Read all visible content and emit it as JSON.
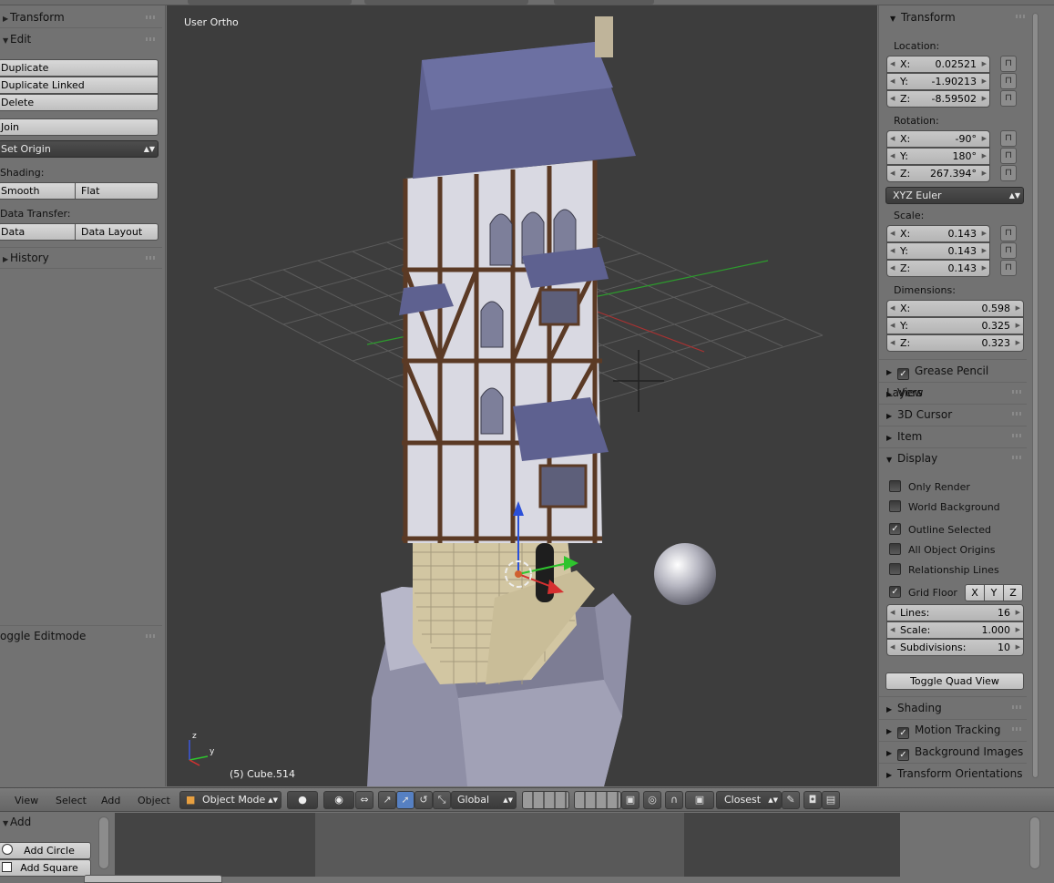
{
  "left_panel": {
    "transform_header": "Transform",
    "edit_header": "Edit",
    "duplicate": "Duplicate",
    "duplicate_linked": "Duplicate Linked",
    "delete": "Delete",
    "join": "Join",
    "set_origin": "Set Origin",
    "shading_label": "Shading:",
    "smooth": "Smooth",
    "flat": "Flat",
    "data_transfer_label": "Data Transfer:",
    "data": "Data",
    "data_layout": "Data Layout",
    "history_header": "History",
    "toggle_editmode": "oggle Editmode"
  },
  "viewport": {
    "view_label": "User Ortho",
    "object_label": "(5) Cube.514",
    "axis_z": "z",
    "axis_y": "y"
  },
  "right_panel": {
    "transform_header": "Transform",
    "location_label": "Location:",
    "location": {
      "x": "0.02521",
      "y": "-1.90213",
      "z": "-8.59502"
    },
    "rotation_label": "Rotation:",
    "rotation": {
      "x": "-90°",
      "y": "180°",
      "z": "267.394°"
    },
    "rotation_mode": "XYZ Euler",
    "scale_label": "Scale:",
    "scale": {
      "x": "0.143",
      "y": "0.143",
      "z": "0.143"
    },
    "dimensions_label": "Dimensions:",
    "dimensions": {
      "x": "0.598",
      "y": "0.325",
      "z": "0.323"
    },
    "axis": {
      "x": "X:",
      "y": "Y:",
      "z": "Z:"
    },
    "grease_pencil": "Grease Pencil Layers",
    "view": "View",
    "cursor_3d": "3D Cursor",
    "item": "Item",
    "display": "Display",
    "only_render": "Only Render",
    "world_background": "World Background",
    "outline_selected": "Outline Selected",
    "all_object_origins": "All Object Origins",
    "relationship_lines": "Relationship Lines",
    "grid_floor": "Grid Floor",
    "grid_x": "X",
    "grid_y": "Y",
    "grid_z": "Z",
    "lines_label": "Lines:",
    "lines_value": "16",
    "grid_scale_label": "Scale:",
    "grid_scale_value": "1.000",
    "subdivisions_label": "Subdivisions:",
    "subdivisions_value": "10",
    "toggle_quad_view": "Toggle Quad View",
    "shading": "Shading",
    "motion_tracking": "Motion Tracking",
    "background_images": "Background Images",
    "transform_orientations": "Transform Orientations"
  },
  "header_bar": {
    "view": "View",
    "select": "Select",
    "add": "Add",
    "object": "Object",
    "mode": "Object Mode",
    "orientation": "Global",
    "snap_target": "Closest"
  },
  "bottom": {
    "add_header": "Add",
    "add_circle": "Add Circle",
    "add_square": "Add Square"
  },
  "colors": {
    "panel_bg": "#727272",
    "viewport_bg": "#3d3d3d",
    "dropdown_dark": "#3a3a3a"
  }
}
